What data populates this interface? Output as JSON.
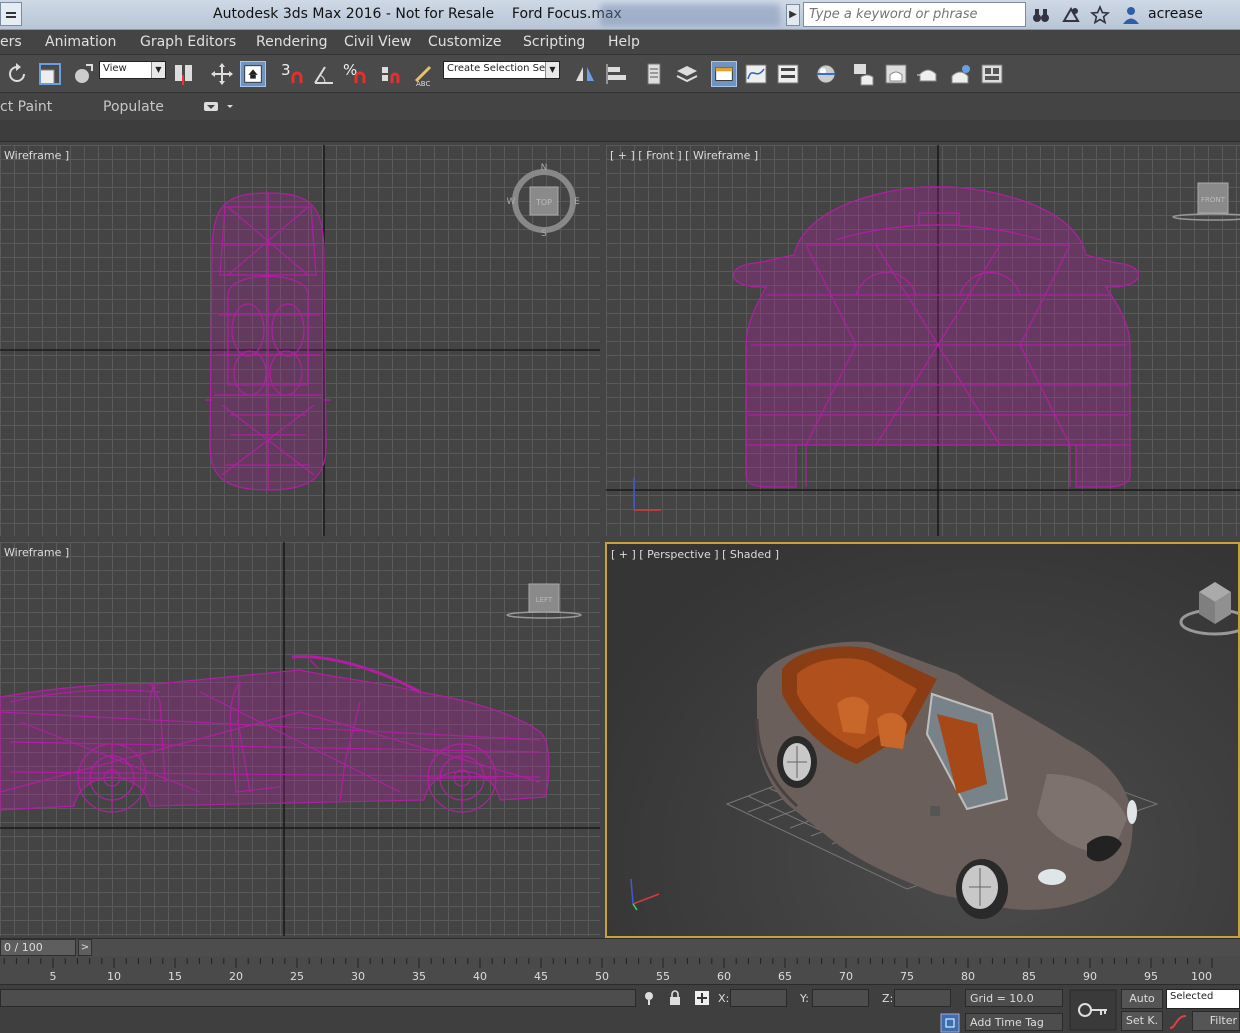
{
  "window": {
    "title": "Autodesk 3ds Max 2016 - Not for Resale    Ford Focus.max",
    "search_placeholder": "Type a keyword or phrase",
    "user": "acrease"
  },
  "menu": [
    "ers",
    "Animation",
    "Graph Editors",
    "Rendering",
    "Civil View",
    "Customize",
    "Scripting",
    "Help"
  ],
  "toolbar": {
    "reference_coord": "View",
    "selection_set": "Create Selection Se",
    "snap_3": "3",
    "snap_percent": "%"
  },
  "ribbon": {
    "tabs": [
      "ct Paint",
      "Populate"
    ]
  },
  "viewports": {
    "top": {
      "label": "Wireframe ]",
      "cube": "TOP",
      "compass": {
        "n": "N",
        "s": "S",
        "e": "E",
        "w": "W"
      }
    },
    "front": {
      "label": "[ + ] [ Front ] [ Wireframe ]",
      "cube": "FRONT"
    },
    "left": {
      "label": "Wireframe ]",
      "cube": "LEFT"
    },
    "perspective": {
      "label": "[ + ] [ Perspective ] [ Shaded ]"
    }
  },
  "colors": {
    "wireframe": "#b01fa2",
    "active_border": "#c6a23a",
    "car_body": "#6b5f5c",
    "car_interior": "#b0501c"
  },
  "timeline": {
    "frame": "0 / 100",
    "next": ">",
    "ticks": [
      "5",
      "10",
      "15",
      "20",
      "25",
      "30",
      "35",
      "40",
      "45",
      "50",
      "55",
      "60",
      "65",
      "70",
      "75",
      "80",
      "85",
      "90",
      "95",
      "100"
    ]
  },
  "status": {
    "x_label": "X:",
    "y_label": "Y:",
    "z_label": "Z:",
    "grid": "Grid = 10.0",
    "add_time_tag": "Add Time Tag",
    "auto": "Auto",
    "set_key": "Set K.",
    "selected": "Selected",
    "filters": "Filter"
  }
}
